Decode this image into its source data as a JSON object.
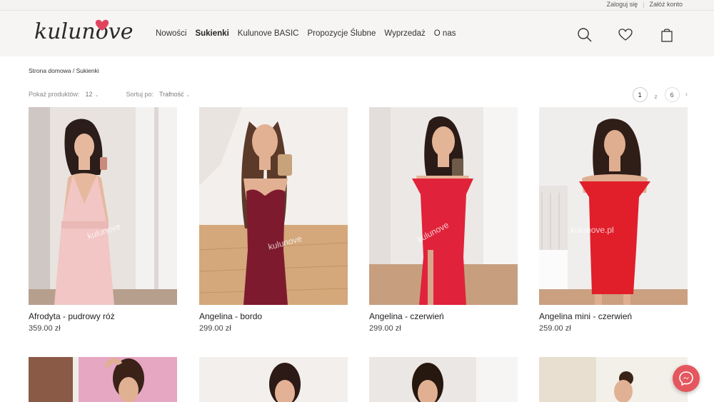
{
  "account": {
    "login": "Zaloguj się",
    "register": "Załóż konto"
  },
  "brand": {
    "name": "kulunove",
    "accent": "#e0445c"
  },
  "nav": [
    {
      "label": "Nowości"
    },
    {
      "label": "Sukienki"
    },
    {
      "label": "Kulunove BASIC"
    },
    {
      "label": "Propozycje Ślubne"
    },
    {
      "label": "Wyprzedaż"
    },
    {
      "label": "O nas"
    }
  ],
  "header_icons": [
    "search-icon",
    "heart-icon",
    "shopping-bag-icon"
  ],
  "breadcrumb": "Strona domowa / Sukienki",
  "toolbar": {
    "show_label": "Pokaż produktów:",
    "show_value": "12",
    "sort_label": "Sortuj po:",
    "sort_value": "Trafność"
  },
  "pagination": {
    "current": "1",
    "of": "z",
    "total": "6"
  },
  "products": [
    {
      "name": "Afrodyta - pudrowy róż",
      "price": "359.00 zł",
      "watermark": "kulunove",
      "dress_color": "#f1c6c4"
    },
    {
      "name": "Angelina - bordo",
      "price": "299.00 zł",
      "watermark": "kulunove",
      "dress_color": "#7e1a2e"
    },
    {
      "name": "Angelina - czerwień",
      "price": "299.00 zł",
      "watermark": "kulunove",
      "dress_color": "#e0233a"
    },
    {
      "name": "Angelina mini - czerwień",
      "price": "259.00 zł",
      "watermark": "kulunove.pl",
      "dress_color": "#e01f2b"
    }
  ],
  "messenger_icon": "messenger-icon"
}
